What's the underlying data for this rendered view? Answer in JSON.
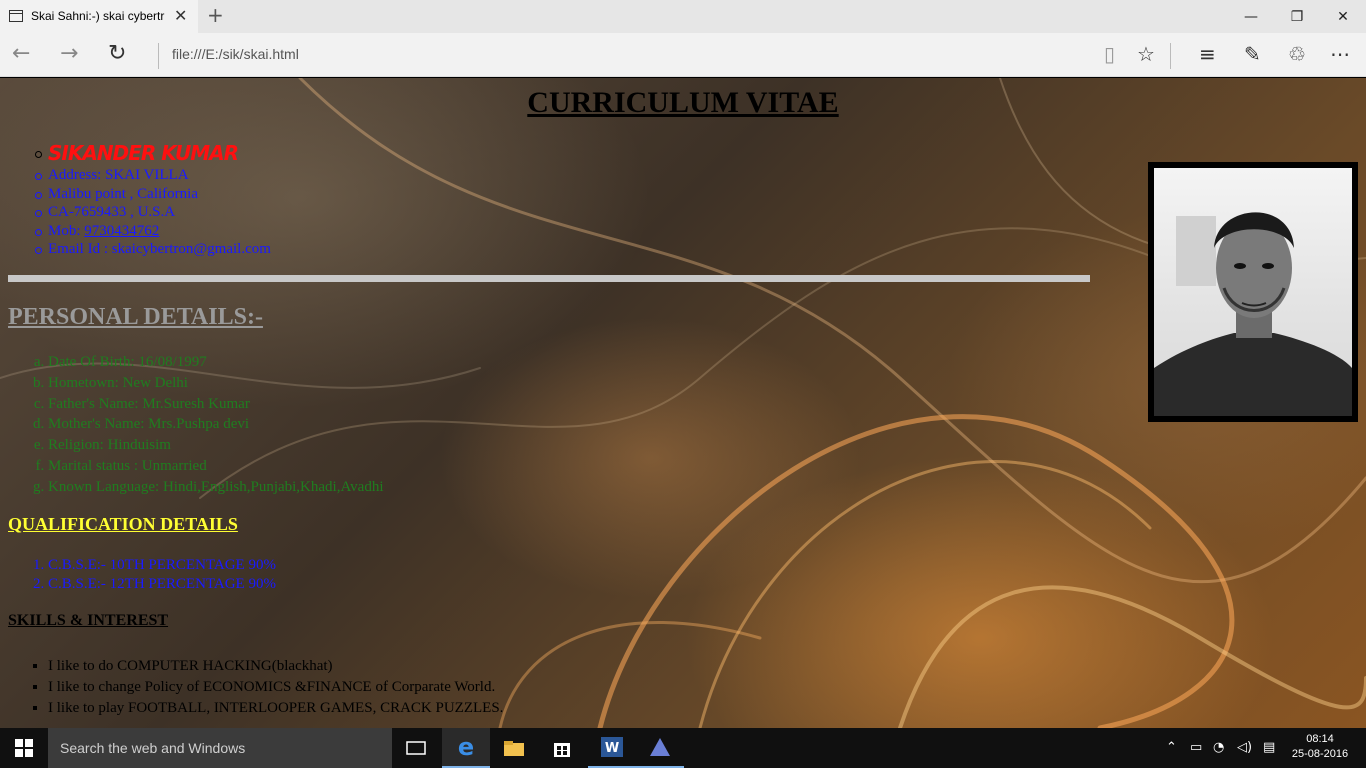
{
  "browser": {
    "tab_title": "Skai Sahni:-) skai cybertr",
    "tab_close": "✕",
    "new_tab": "+",
    "url": "file:///E:/sik/skai.html",
    "window_controls": {
      "minimize": "—",
      "restore": "❐",
      "close": "✕"
    },
    "icons": [
      "back-icon",
      "forward-icon",
      "refresh-icon",
      "reading-view-icon",
      "favorite-star-icon",
      "hub-icon",
      "web-note-icon",
      "share-icon",
      "more-icon"
    ]
  },
  "page": {
    "title": "CURRICULUM VITAE",
    "contact": {
      "name": "SIKANDER KUMAR",
      "address": "Address: SKAI VILLA",
      "line2": "Malibu point , California",
      "line3": "CA-7659433 , U.S.A",
      "mob_label": "Mob: ",
      "mob_value": "9730434762",
      "email": "Email Id : skaicybertron@gmail.com"
    },
    "personal_heading": "PERSONAL DETAILS:-",
    "personal": [
      "Date Of Birth: 16/08/1997",
      "Hometown: New Delhi",
      "Father's Name: Mr.Suresh Kumar",
      "Mother's Name: Mrs.Pushpa devi",
      "Religion: Hinduisim",
      "Marital status : Unmarried",
      "Known Language: Hindi,English,Punjabi,Khadi,Avadhi"
    ],
    "qual_heading": "QUALIFICATION DETAILS",
    "qualifications": [
      "C.B.S.E:- 10TH PERCENTAGE 90%",
      "C.B.S.E:- 12TH PERCENTAGE 90%"
    ],
    "skills_heading": "SKILLS & INTEREST",
    "skills": [
      "I like to do COMPUTER HACKING(blackhat)",
      "I like to change Policy of ECONOMICS &FINANCE of Corparate World.",
      "I like to play FOOTBALL, INTERLOOPER GAMES, CRACK PUZZLES."
    ],
    "colors": {
      "name": "#ff1010",
      "contact": "#1a1aff",
      "personal": "#1f7d1f",
      "qual_heading": "#ffff33",
      "personal_heading": "#9a9a9a"
    }
  },
  "taskbar": {
    "search_placeholder": "Search the web and Windows",
    "apps": [
      "task-view-icon",
      "edge-icon",
      "file-explorer-icon",
      "store-icon",
      "word-icon",
      "app-icon"
    ],
    "time": "08:14",
    "date": "25-08-2016"
  }
}
